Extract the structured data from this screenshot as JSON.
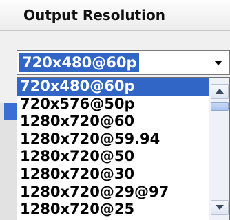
{
  "panel": {
    "title": "Output Resolution"
  },
  "combo": {
    "selected_value": "720x480@60p"
  },
  "dropdown": {
    "items": [
      {
        "label": "720x480@60p",
        "selected": true
      },
      {
        "label": "720x576@50p",
        "selected": false
      },
      {
        "label": "1280x720@60",
        "selected": false
      },
      {
        "label": "1280x720@59.94",
        "selected": false
      },
      {
        "label": "1280x720@50",
        "selected": false
      },
      {
        "label": "1280x720@30",
        "selected": false
      },
      {
        "label": "1280x720@29@97",
        "selected": false
      },
      {
        "label": "1280x720@25",
        "selected": false
      }
    ]
  },
  "icons": {
    "combo_arrow": "chevron-down-icon",
    "scroll_up": "scroll-up-icon",
    "scroll_down": "scroll-down-icon"
  },
  "colors": {
    "selection": "#3166c6",
    "background": "#f0f0f0"
  }
}
